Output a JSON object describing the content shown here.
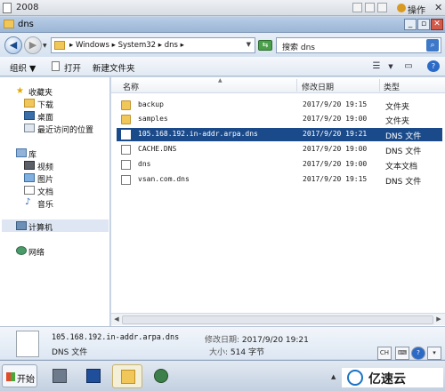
{
  "vm_window": {
    "title": "2008",
    "action_label": "操作"
  },
  "explorer_window": {
    "title": "dns"
  },
  "address_bar": {
    "path": "▸ Windows ▸ System32 ▸ dns ▸",
    "search_placeholder": "搜索 dns"
  },
  "toolbar": {
    "organize_label": "组织 ▼",
    "open_label": "打开",
    "new_folder_label": "新建文件夹"
  },
  "nav_pane": {
    "favorites": {
      "label": "收藏夹",
      "items": [
        {
          "label": "下载",
          "icon": "download-folder-icon"
        },
        {
          "label": "桌面",
          "icon": "desktop-icon"
        },
        {
          "label": "最近访问的位置",
          "icon": "recent-places-icon"
        }
      ]
    },
    "libraries": {
      "label": "库",
      "items": [
        {
          "label": "视频",
          "icon": "video-library-icon"
        },
        {
          "label": "图片",
          "icon": "pictures-library-icon"
        },
        {
          "label": "文档",
          "icon": "documents-library-icon"
        },
        {
          "label": "音乐",
          "icon": "music-library-icon"
        }
      ]
    },
    "computer_label": "计算机",
    "network_label": "网络"
  },
  "file_list": {
    "columns": {
      "name": "名称",
      "date": "修改日期",
      "type": "类型"
    },
    "rows": [
      {
        "name": "backup",
        "date": "2017/9/20 19:15",
        "type": "文件夹",
        "kind": "folder"
      },
      {
        "name": "samples",
        "date": "2017/9/20 19:00",
        "type": "文件夹",
        "kind": "folder"
      },
      {
        "name": "105.168.192.in-addr.arpa.dns",
        "date": "2017/9/20 19:21",
        "type": "DNS 文件",
        "kind": "file",
        "selected": true
      },
      {
        "name": "CACHE.DNS",
        "date": "2017/9/20 19:00",
        "type": "DNS 文件",
        "kind": "file"
      },
      {
        "name": "dns",
        "date": "2017/9/20 19:00",
        "type": "文本文档",
        "kind": "file"
      },
      {
        "name": "vsan.com.dns",
        "date": "2017/9/20 19:15",
        "type": "DNS 文件",
        "kind": "file"
      }
    ]
  },
  "details_pane": {
    "file_name": "105.168.192.in-addr.arpa.dns",
    "file_type": "DNS 文件",
    "modified_label": "修改日期:",
    "modified_value": "2017/9/20 19:21",
    "size_label": "大小:",
    "size_value": "514 字节"
  },
  "taskbar": {
    "start_label": "开始",
    "tray_ime": "CH",
    "brand_text": "亿速云"
  },
  "colors": {
    "selection": "#1a4a8a",
    "folder": "#f1c75a",
    "chrome": "#d6e2f0"
  }
}
